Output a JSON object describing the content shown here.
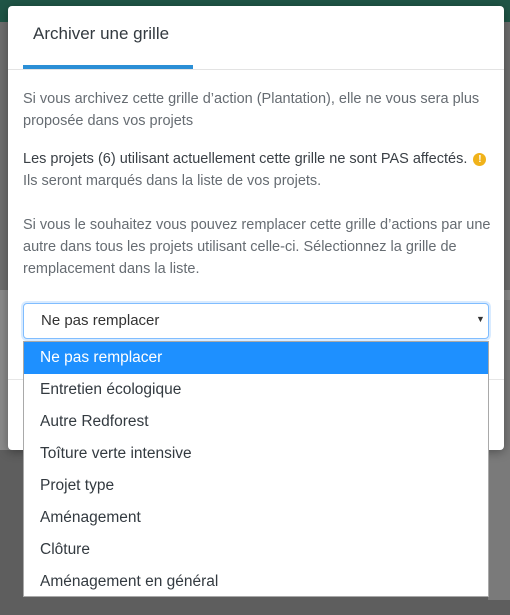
{
  "dialog": {
    "title": "Archiver une grille",
    "paragraph_1": "Si vous archivez cette grille d’action (Plantation), elle ne vous sera plus proposée dans vos projets",
    "paragraph_2_strong": "Les projets (6) utilisant actuellement cette grille ne sont PAS affectés.",
    "paragraph_2_rest": "Ils seront marqués dans la liste de vos projets.",
    "paragraph_3": "Si vous le souhaitez vous pouvez remplacer cette grille d’actions par une autre dans tous les projets utilisant celle-ci. Sélectionnez la grille de remplacement dans la liste.",
    "warning_icon": "info-circle-icon",
    "warning_color": "#f0b21a",
    "accent_color": "#2b8fd6"
  },
  "replacement_select": {
    "selected": "Ne pas remplacer",
    "options": [
      "Ne pas remplacer",
      "Entretien écologique",
      "Autre Redforest",
      "Toîture verte intensive",
      "Projet type",
      "Aménagement",
      "Clôture",
      "Aménagement en général"
    ],
    "highlight_color": "#1e90ff"
  }
}
